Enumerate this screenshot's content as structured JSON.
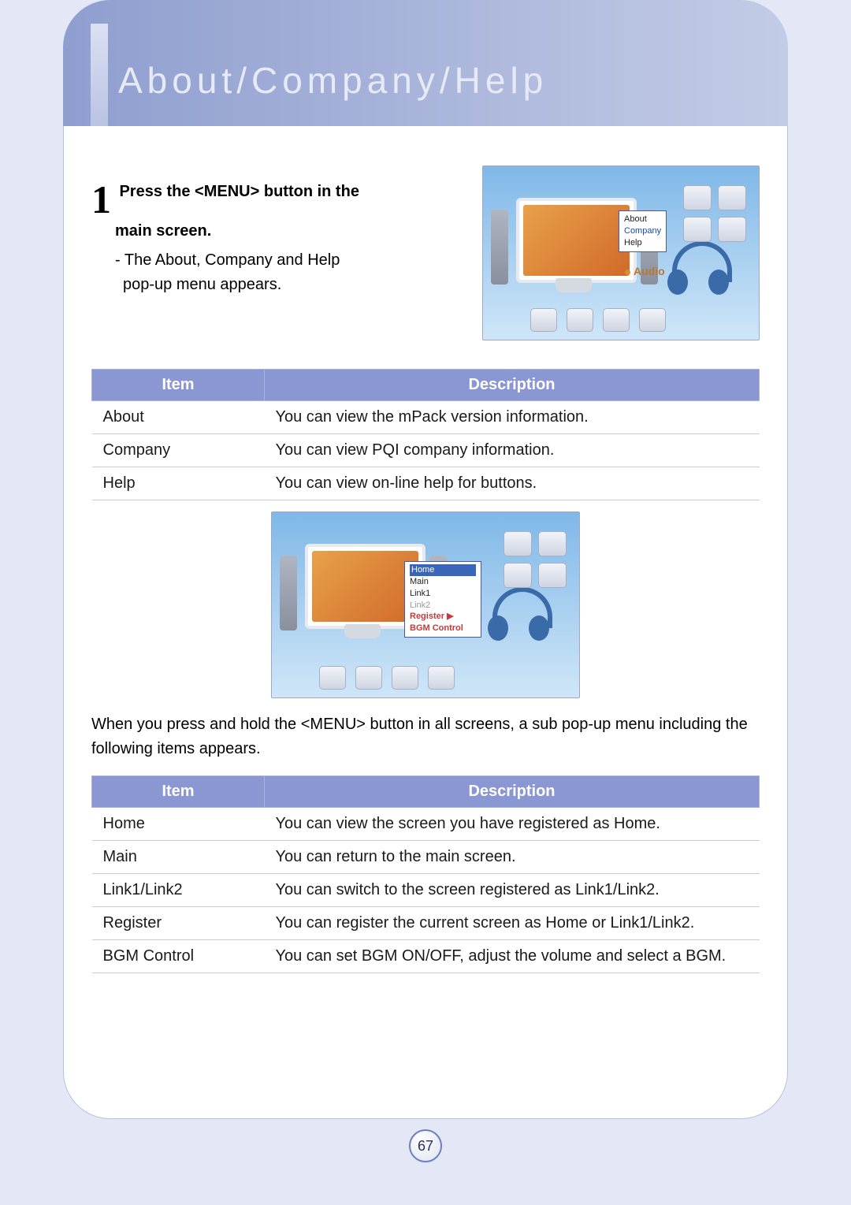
{
  "header": {
    "title": "About/Company/Help"
  },
  "step1": {
    "num": "1",
    "bold_a": "Press the <MENU> button in the",
    "bold_b": "main screen.",
    "sub_a": "- The About, Company and Help",
    "sub_b": "  pop-up menu appears."
  },
  "popup1": {
    "items": [
      "About",
      "Company",
      "Help"
    ],
    "label": "Audio"
  },
  "table1": {
    "head_item": "Item",
    "head_desc": "Description",
    "rows": [
      {
        "item": "About",
        "desc": "You can view the mPack version information."
      },
      {
        "item": "Company",
        "desc": "You can view PQI company information."
      },
      {
        "item": "Help",
        "desc": "You can view on-line help for buttons."
      }
    ]
  },
  "popup2": {
    "items": [
      "Home",
      "Main",
      "Link1",
      "Link2",
      "Register   ▶",
      "BGM Control"
    ]
  },
  "mid_text": "When you press and hold the <MENU> button in all screens, a sub pop-up menu including the following items appears.",
  "table2": {
    "head_item": "Item",
    "head_desc": "Description",
    "rows": [
      {
        "item": "Home",
        "desc": "You can view the screen you have registered as Home."
      },
      {
        "item": "Main",
        "desc": "You can return to the main screen."
      },
      {
        "item": "Link1/Link2",
        "desc": "You can switch to the screen registered as Link1/Link2."
      },
      {
        "item": "Register",
        "desc": "You can register the current screen as Home or Link1/Link2."
      },
      {
        "item": "BGM Control",
        "desc": "You can set BGM ON/OFF, adjust the volume and select a BGM."
      }
    ]
  },
  "page_number": "67"
}
